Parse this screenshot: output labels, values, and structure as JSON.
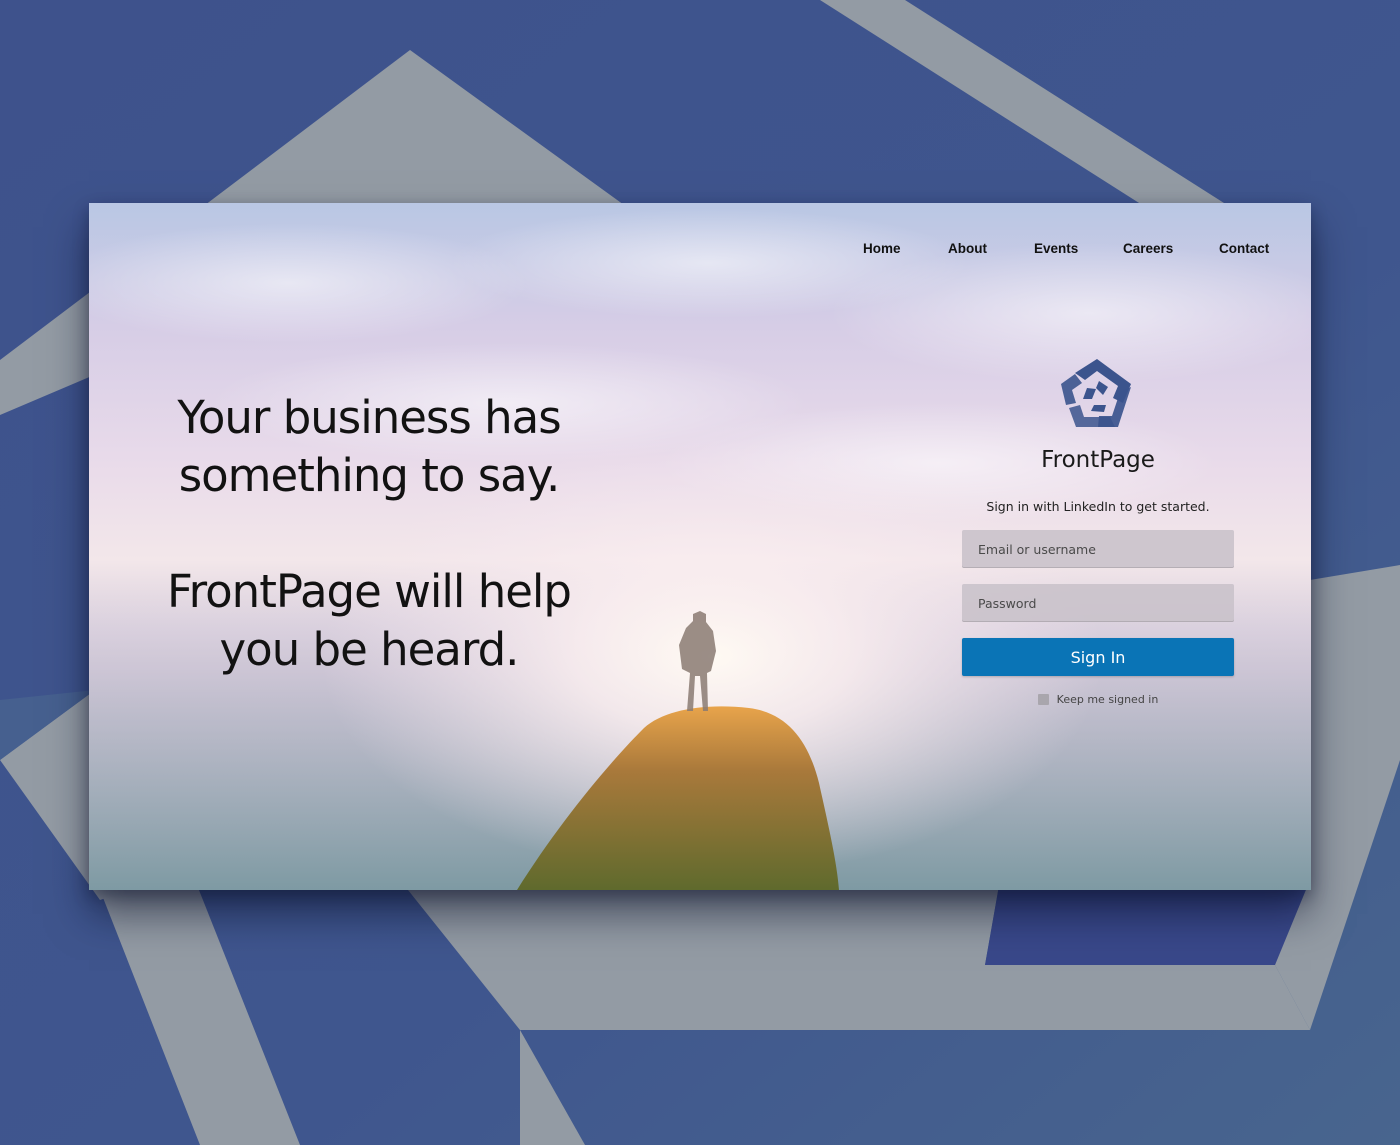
{
  "nav": {
    "items": [
      {
        "label": "Home"
      },
      {
        "label": "About"
      },
      {
        "label": "Events"
      },
      {
        "label": "Careers"
      },
      {
        "label": "Contact"
      }
    ]
  },
  "hero": {
    "headline_1": "Your business has something to say.",
    "headline_2": "FrontPage will help you be heard."
  },
  "signin": {
    "logo_icon": "pentagon-logo-icon",
    "brand": "FrontPage",
    "tagline": "Sign in with LinkedIn to get started.",
    "email_placeholder": "Email or username",
    "password_placeholder": "Password",
    "button_label": "Sign In",
    "keep_signed_in_label": "Keep me signed in",
    "keep_signed_in_checked": false
  },
  "colors": {
    "background": "#3d5189",
    "band": "#939ba4",
    "logo": "#3b548d",
    "button": "#0a74b6"
  }
}
